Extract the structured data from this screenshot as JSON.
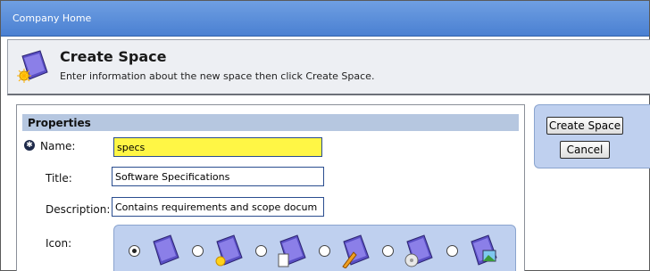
{
  "breadcrumb": "Company Home",
  "header": {
    "title": "Create Space",
    "subtitle": "Enter information about the new space then click Create Space.",
    "icon": "space-create-icon"
  },
  "properties": {
    "section_title": "Properties",
    "name_label": "Name:",
    "name_value": "specs",
    "title_label": "Title:",
    "title_value": "Software Specifications",
    "description_label": "Description:",
    "description_value": "Contains requirements and scope docum",
    "icon_label": "Icon:",
    "icon_options": [
      {
        "name": "space-icon",
        "selected": true
      },
      {
        "name": "space-sun-icon",
        "selected": false
      },
      {
        "name": "space-document-icon",
        "selected": false
      },
      {
        "name": "space-pencil-icon",
        "selected": false
      },
      {
        "name": "space-disc-icon",
        "selected": false
      },
      {
        "name": "space-picture-icon",
        "selected": false
      }
    ]
  },
  "actions": {
    "create_label": "Create Space",
    "cancel_label": "Cancel"
  },
  "colors": {
    "topbar": "#4a80d2",
    "section": "#b6c7e0",
    "panel": "#bfd0ef",
    "required_field": "#fff645"
  }
}
